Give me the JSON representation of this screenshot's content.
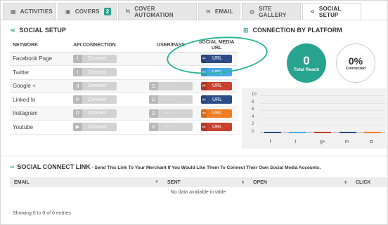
{
  "tabs": [
    {
      "label": "ACTIVITIES",
      "icon": "chart-icon"
    },
    {
      "label": "COVERS",
      "icon": "image-icon",
      "badge": "2"
    },
    {
      "label": "COVER AUTOMATION",
      "icon": "bolt-icon"
    },
    {
      "label": "EMAIL",
      "icon": "envelope-icon"
    },
    {
      "label": "SITE GALLERY",
      "icon": "globe-icon"
    },
    {
      "label": "SOCIAL SETUP",
      "icon": "share-icon",
      "active": true
    }
  ],
  "social_setup": {
    "title": "SOCIAL SETUP",
    "columns": [
      "NETWORK",
      "API CONNECTION",
      "USER/PASS",
      "SOCIAL MEDIA URL"
    ],
    "rows": [
      {
        "network": "Facebook Page",
        "connect": "Connect",
        "user_pass": "",
        "url": "URL",
        "url_color": "#2c4c8a"
      },
      {
        "network": "Twitter",
        "connect": "Connect",
        "user_pass": "",
        "url": "URL",
        "url_color": "#47a9e5"
      },
      {
        "network": "Google +",
        "connect": "Connect",
        "user_pass": "- - - -",
        "url": "URL",
        "url_color": "#c7412e"
      },
      {
        "network": "Linked In",
        "connect": "Connect",
        "user_pass": "- - - -",
        "url": "URL",
        "url_color": "#2c4c8a"
      },
      {
        "network": "Instagram",
        "connect": "Connect",
        "user_pass": "- - - -",
        "url": "URL",
        "url_color": "#f07d22"
      },
      {
        "network": "Youtube",
        "connect": "Connect",
        "user_pass": "- - - -",
        "url": "URL",
        "url_color": "#c7412e"
      }
    ]
  },
  "connection": {
    "title": "CONNECTION BY PLATFORM",
    "total_reach_value": "0",
    "total_reach_label": "Total Reach",
    "connected_value": "0%",
    "connected_label": "Connected"
  },
  "chart_data": {
    "type": "bar",
    "categories": [
      "facebook",
      "twitter",
      "google+",
      "linkedin",
      "instagram"
    ],
    "values": [
      0,
      0,
      0,
      0,
      0
    ],
    "yticks": [
      "10",
      "8",
      "6",
      "4",
      "2",
      "0"
    ],
    "ylim": [
      0,
      10
    ],
    "colors": [
      "#2c4c8a",
      "#47a9e5",
      "#c7412e",
      "#2c4c8a",
      "#f07d22"
    ]
  },
  "connect_link": {
    "title": "SOCIAL CONNECT LINK",
    "subtitle": " - Send This Link To Your Merchant If You Would Like Them To Connect Their Own Social Media Accounts.",
    "columns": [
      "EMAIL",
      "SENT",
      "OPEN",
      "CLICK"
    ],
    "empty": "No data available in table",
    "showing": "Showing 0 to 0 of 0 entries"
  },
  "colors": {
    "accent": "#27a38e"
  }
}
